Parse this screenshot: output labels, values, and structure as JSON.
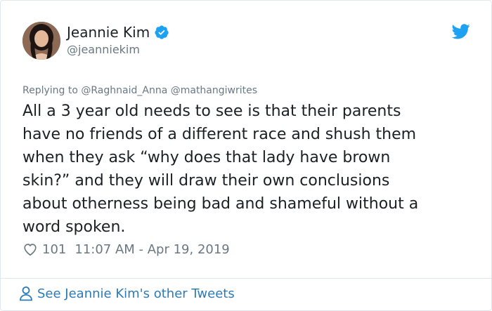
{
  "author": {
    "name": "Jeannie Kim",
    "handle": "@jeanniekim",
    "verified": true
  },
  "reply": {
    "prefix": "Replying to",
    "mentions": "@Raghnaid_Anna @mathangiwrites"
  },
  "tweet": {
    "text": "All a 3 year old needs to see is that their parents\nhave no friends of a different race and shush them\nwhen they ask “why does that lady have brown\nskin?” and they will draw their own conclusions\nabout otherness being bad and shameful without a\nword spoken."
  },
  "meta": {
    "likes": "101",
    "timestamp": "11:07 AM - Apr 19, 2019"
  },
  "footer": {
    "link": "See Jeannie Kim's other Tweets"
  },
  "icons": {
    "verified": "verified-badge-icon",
    "bird": "twitter-bird-icon",
    "heart": "heart-icon",
    "person": "person-icon"
  },
  "colors": {
    "brand": "#1da1f2",
    "link": "#2b7bb9",
    "muted": "#697882",
    "text": "#1c2022"
  }
}
